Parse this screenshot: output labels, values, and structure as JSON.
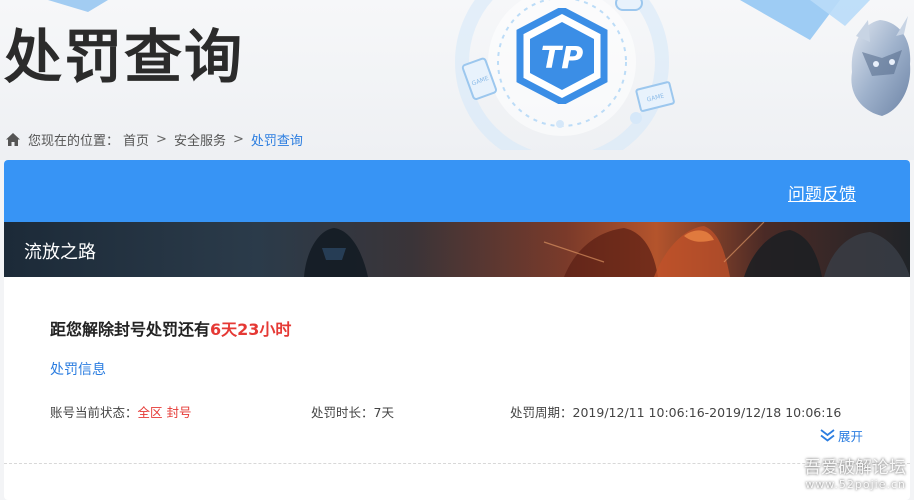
{
  "header": {
    "title": "处罚查询",
    "logo_text": "TP",
    "deco_label_left": "GAME",
    "deco_label_right": "GAME"
  },
  "breadcrumb": {
    "prefix": "您现在的位置：",
    "items": [
      "首页",
      "安全服务",
      "处罚查询"
    ],
    "separator": ">"
  },
  "toolbar": {
    "feedback_label": "问题反馈"
  },
  "banner": {
    "game_name": "流放之路"
  },
  "punishment": {
    "countdown_prefix": "距您解除封号处罚还有",
    "countdown_remaining": "6天23小时",
    "info_title": "处罚信息",
    "status_label": "账号当前状态：",
    "status_value": "全区 封号",
    "duration_label": "处罚时长：",
    "duration_value": "7天",
    "period_label": "处罚周期：",
    "period_value": "2019/12/11 10:06:16-2019/12/18 10:06:16",
    "expand_label": "展开"
  },
  "watermark": {
    "text": "吾爱破解论坛",
    "url": "www.52pojie.cn"
  },
  "colors": {
    "accent": "#3794f5",
    "link": "#2b7de0",
    "alert": "#e53935"
  },
  "icons": {
    "home": "home-icon",
    "logo": "tp-logo-icon",
    "expand": "chevron-double-down-icon"
  }
}
